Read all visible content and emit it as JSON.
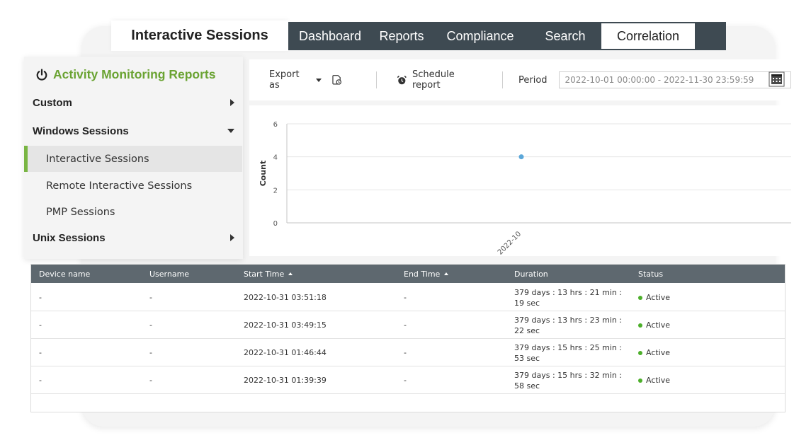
{
  "title_tab": "Interactive Sessions",
  "nav_tabs": [
    "Dashboard",
    "Reports",
    "Compliance",
    "Search",
    "Correlation"
  ],
  "active_nav_tab": "Correlation",
  "sidebar": {
    "title": "Activity Monitoring Reports",
    "title_icon": "power-icon",
    "sections": [
      {
        "label": "Custom",
        "state": "collapsed"
      },
      {
        "label": "Windows Sessions",
        "state": "expanded",
        "items": [
          "Interactive Sessions",
          "Remote Interactive Sessions",
          "PMP Sessions"
        ],
        "active_item": "Interactive Sessions"
      },
      {
        "label": "Unix Sessions",
        "state": "collapsed"
      }
    ]
  },
  "toolbar": {
    "export_label": "Export as",
    "schedule_label": "Schedule report",
    "period_label": "Period",
    "period_value": "2022-10-01 00:00:00 - 2022-11-30 23:59:59"
  },
  "colors": {
    "accent_green": "#6aa332",
    "nav_bg": "#3e4a52",
    "table_header_bg": "#5e686f",
    "point_color": "#5ba7d9",
    "status_active": "#4caf2a"
  },
  "chart_data": {
    "type": "scatter",
    "title": "",
    "xlabel": "",
    "ylabel": "Count",
    "categories": [
      "2022-10"
    ],
    "values": [
      4
    ],
    "ylim": [
      0,
      6
    ],
    "yticks": [
      0,
      2,
      4,
      6
    ],
    "grid": true,
    "legend": "none"
  },
  "table": {
    "columns": [
      {
        "label": "Device name",
        "sortable": false
      },
      {
        "label": "Username",
        "sortable": false
      },
      {
        "label": "Start Time",
        "sortable": true
      },
      {
        "label": "End Time",
        "sortable": true
      },
      {
        "label": "Duration",
        "sortable": false
      },
      {
        "label": "Status",
        "sortable": false
      }
    ],
    "rows": [
      [
        "-",
        "-",
        "2022-10-31 03:51:18",
        "-",
        "379 days : 13 hrs : 21 min : 19 sec",
        "Active"
      ],
      [
        "-",
        "-",
        "2022-10-31 03:49:15",
        "-",
        "379 days : 13 hrs : 23 min : 22 sec",
        "Active"
      ],
      [
        "-",
        "-",
        "2022-10-31 01:46:44",
        "-",
        "379 days : 15 hrs : 25 min : 53 sec",
        "Active"
      ],
      [
        "-",
        "-",
        "2022-10-31 01:39:39",
        "-",
        "379 days : 15 hrs : 32 min : 58 sec",
        "Active"
      ]
    ]
  }
}
